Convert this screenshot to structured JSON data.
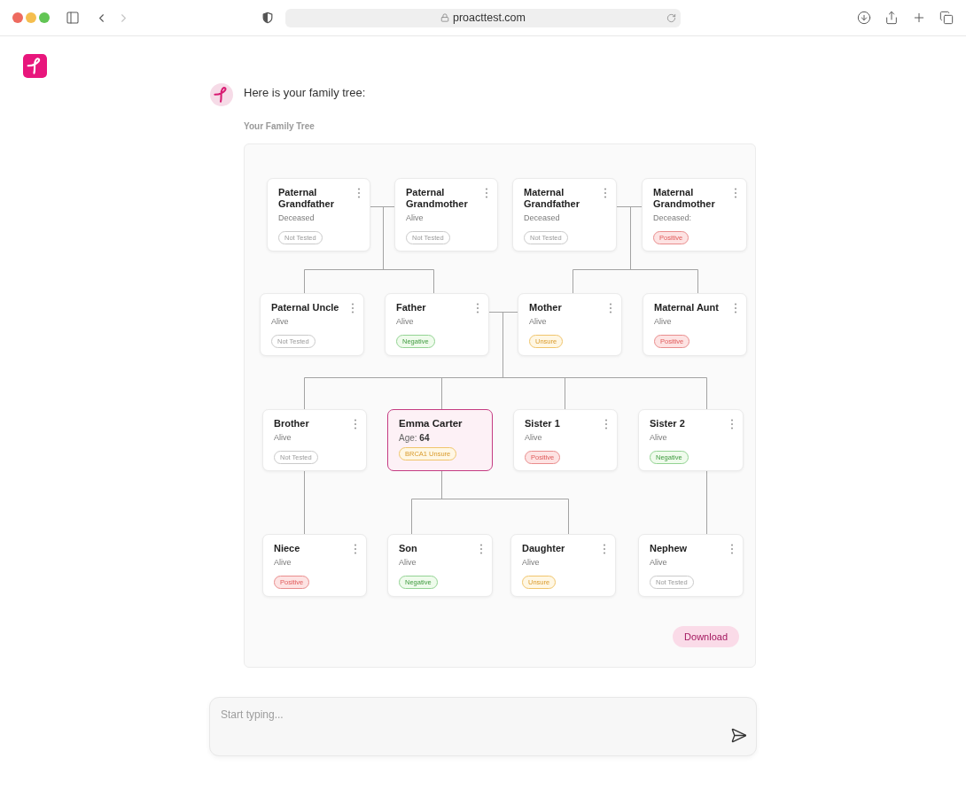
{
  "browser": {
    "url": "proacttest.com",
    "back_disabled": false,
    "forward_disabled": true
  },
  "chat": {
    "message": "Here is your family tree:",
    "section_title": "Your Family Tree"
  },
  "tree": {
    "generations": [
      {
        "members": [
          {
            "name": "Paternal Grandfather",
            "status": "Deceased",
            "result": {
              "label": "Not Tested",
              "kind": "not_tested"
            },
            "selected": false
          },
          {
            "name": "Paternal Grandmother",
            "status": "Alive",
            "result": {
              "label": "Not Tested",
              "kind": "not_tested"
            },
            "selected": false
          },
          {
            "name": "Maternal Grandfather",
            "status": "Deceased",
            "result": {
              "label": "Not Tested",
              "kind": "not_tested"
            },
            "selected": false
          },
          {
            "name": "Maternal Grandmother",
            "status": "Deceased:",
            "result": {
              "label": "Positive",
              "kind": "positive"
            },
            "selected": false
          }
        ]
      },
      {
        "members": [
          {
            "name": "Paternal Uncle",
            "status": "Alive",
            "result": {
              "label": "Not Tested",
              "kind": "not_tested"
            },
            "selected": false
          },
          {
            "name": "Father",
            "status": "Alive",
            "result": {
              "label": "Negative",
              "kind": "negative"
            },
            "selected": false
          },
          {
            "name": "Mother",
            "status": "Alive",
            "result": {
              "label": "Unsure",
              "kind": "unsure"
            },
            "selected": false
          },
          {
            "name": "Maternal Aunt",
            "status": "Alive",
            "result": {
              "label": "Positive",
              "kind": "positive"
            },
            "selected": false
          }
        ]
      },
      {
        "members": [
          {
            "name": "Brother",
            "status": "Alive",
            "result": {
              "label": "Not Tested",
              "kind": "not_tested"
            },
            "selected": false
          },
          {
            "name": "Emma Carter",
            "status": "Age: **64**",
            "result": {
              "label": "BRCA1 Unsure",
              "kind": "unsure"
            },
            "selected": true
          },
          {
            "name": "Sister 1",
            "status": "Alive",
            "result": {
              "label": "Positive",
              "kind": "positive"
            },
            "selected": false
          },
          {
            "name": "Sister 2",
            "status": "Alive",
            "result": {
              "label": "Negative",
              "kind": "negative"
            },
            "selected": false
          }
        ]
      },
      {
        "members": [
          {
            "name": "Niece",
            "status": "Alive",
            "result": {
              "label": "Positive",
              "kind": "positive"
            },
            "selected": false
          },
          {
            "name": "Son",
            "status": "Alive",
            "result": {
              "label": "Negative",
              "kind": "negative"
            },
            "selected": false
          },
          {
            "name": "Daughter",
            "status": "Alive",
            "result": {
              "label": "Unsure",
              "kind": "unsure"
            },
            "selected": false
          },
          {
            "name": "Nephew",
            "status": "Alive",
            "result": {
              "label": "Not Tested",
              "kind": "not_tested"
            },
            "selected": false
          }
        ]
      }
    ],
    "download_button": "Download"
  },
  "composer": {
    "placeholder": "Start typing..."
  }
}
